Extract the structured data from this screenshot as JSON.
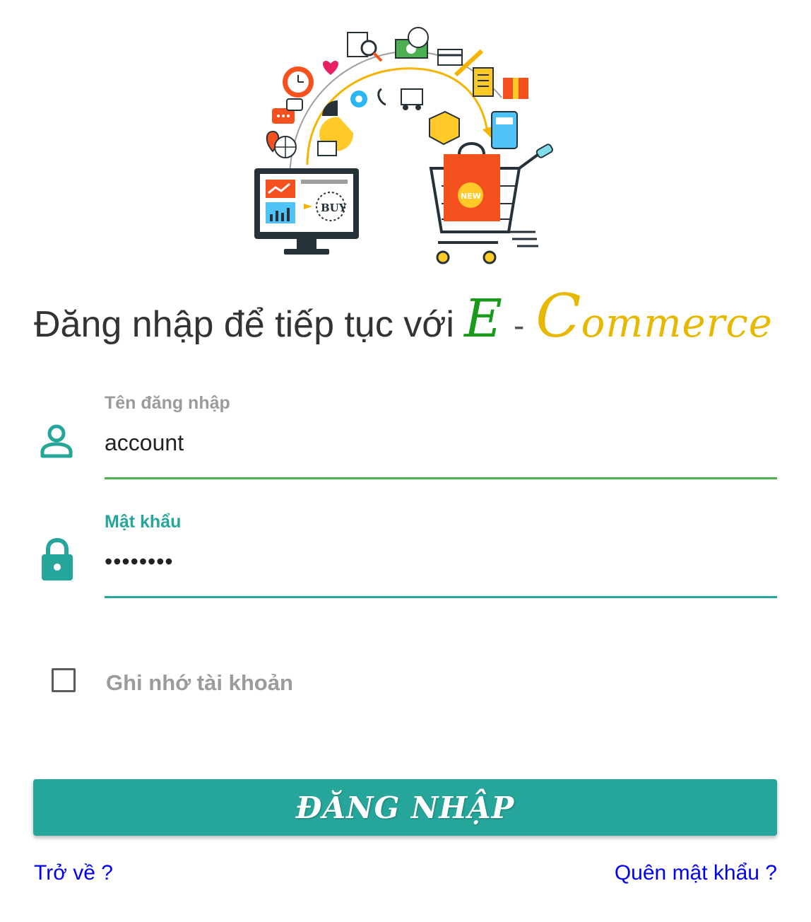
{
  "header": {
    "hero_image": "ecommerce-illustration",
    "title_prefix": "Đăng nhập để tiếp tục với",
    "brand_e": "E",
    "brand_dash": "-",
    "brand_c": "C",
    "brand_rest": "ommerce"
  },
  "form": {
    "username": {
      "label": "Tên đăng nhập",
      "value": "account",
      "icon": "user-icon"
    },
    "password": {
      "label": "Mật khẩu",
      "value": "password",
      "icon": "lock-icon"
    },
    "remember": {
      "label": "Ghi nhớ tài khoản",
      "checked": false
    },
    "submit_label": "ĐĂNG NHẬP"
  },
  "links": {
    "back": "Trở về ?",
    "forgot": "Quên mật khẩu ?"
  },
  "colors": {
    "accent": "#26a69a",
    "username_underline": "#4caf50",
    "brand_e": "#1a9a1a",
    "brand_commerce": "#e6b800",
    "link": "#0000ee"
  }
}
